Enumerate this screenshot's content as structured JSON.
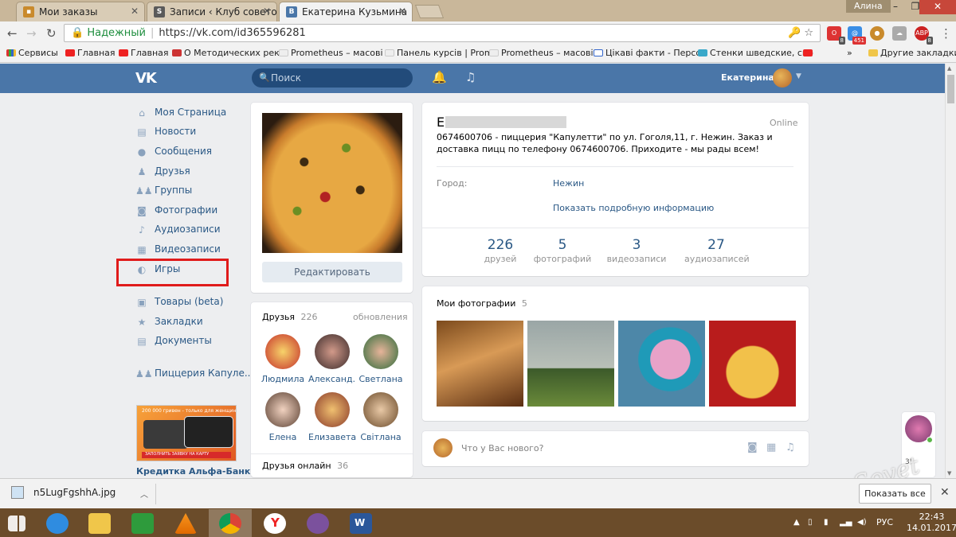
{
  "browser": {
    "tabs": [
      {
        "title": "Мои заказы",
        "icon": "bag-icon"
      },
      {
        "title": "Записи ‹ Клуб советов",
        "icon": "s-icon"
      },
      {
        "title": "Екатерина Кузьмина",
        "icon": "vk-icon"
      }
    ],
    "user_chip": "Алина",
    "address": {
      "secure_label": "Надежный",
      "url": "https://vk.com/id365596281"
    },
    "bookmarks": [
      "Сервисы",
      "Главная",
      "Главная",
      "О Методических рек",
      "Prometheus – масові",
      "Панель курсів | Prom",
      "Prometheus – масові",
      "Цікаві факти - Персо",
      "Стенки шведские, спо"
    ],
    "other_bookmarks": "Другие закладки",
    "extension_badges": [
      "8",
      "451",
      "8"
    ]
  },
  "vk": {
    "logo": "VK",
    "search_placeholder": "Поиск",
    "user_name": "Екатерина",
    "menu": [
      {
        "label": "Моя Страница",
        "icon": "home-icon"
      },
      {
        "label": "Новости",
        "icon": "news-icon"
      },
      {
        "label": "Сообщения",
        "icon": "message-icon"
      },
      {
        "label": "Друзья",
        "icon": "user-icon"
      },
      {
        "label": "Группы",
        "icon": "group-icon"
      },
      {
        "label": "Фотографии",
        "icon": "camera-icon"
      },
      {
        "label": "Аудиозаписи",
        "icon": "music-icon"
      },
      {
        "label": "Видеозаписи",
        "icon": "video-icon"
      },
      {
        "label": "Игры",
        "icon": "gamepad-icon"
      },
      {
        "label": "Товары (beta)",
        "icon": "bag-icon"
      },
      {
        "label": "Закладки",
        "icon": "star-icon"
      },
      {
        "label": "Документы",
        "icon": "document-icon"
      },
      {
        "label": "Пиццерия Капуле..",
        "icon": "group-icon"
      }
    ],
    "ad": {
      "title": "Кредитка Альфа-Банк",
      "banner_text": "200 000 гривен - только для женщин",
      "button_text": "ЗАПОЛНИТЬ ЗАЯВКУ НА КАРТУ"
    },
    "edit_button": "Редактировать",
    "friends_block": {
      "title": "Друзья",
      "count": "226",
      "updates_link": "обновления",
      "friends": [
        "Людмила",
        "Александ..",
        "Светлана",
        "Елена",
        "Елизавета",
        "Світлана"
      ],
      "online_title": "Друзья онлайн",
      "online_count": "36"
    },
    "profile": {
      "name_initial": "Е",
      "status": "Online",
      "bio": "0674600706 - пиццерия \"Капулетти\" по ул. Гоголя,11, г. Нежин. Заказ и доставка пицц по телефону 0674600706. Приходите - мы рады всем!",
      "city_label": "Город:",
      "city_value": "Нежин",
      "more_info": "Показать подробную информацию",
      "counters": [
        {
          "value": "226",
          "label": "друзей"
        },
        {
          "value": "5",
          "label": "фотографий"
        },
        {
          "value": "3",
          "label": "видеозаписи"
        },
        {
          "value": "27",
          "label": "аудиозаписей"
        }
      ]
    },
    "photos_block": {
      "title": "Мои фотографии",
      "count": "5"
    },
    "post_box": {
      "placeholder": "Что у Вас нового?"
    },
    "right_widget": {
      "count": "35"
    }
  },
  "downloads": {
    "file": "n5LugFgshhA.jpg",
    "show_all": "Показать все"
  },
  "taskbar": {
    "lang": "РУС",
    "time": "22:43",
    "date": "14.01.2017"
  },
  "colors": {
    "vk_blue": "#4a76a8",
    "link": "#2a5885",
    "highlight": "#e01b1b",
    "page_bg": "#edeef0"
  }
}
